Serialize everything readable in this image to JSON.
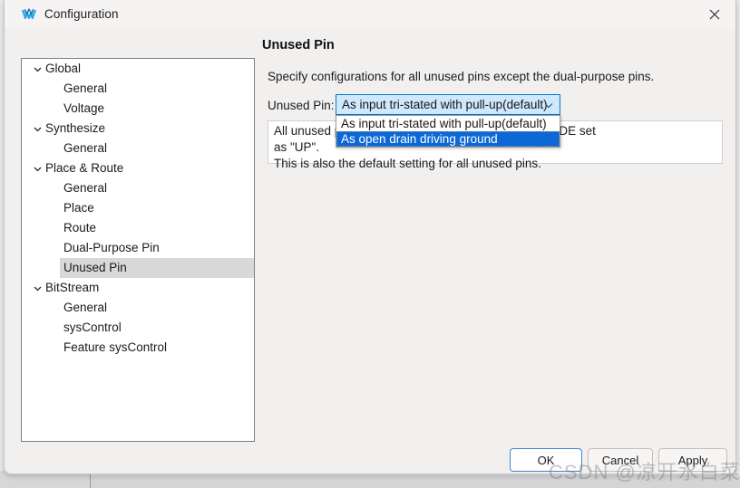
{
  "window": {
    "title": "Configuration",
    "app_icon": "w-logo-icon",
    "close_icon": "close-icon"
  },
  "sidebar": {
    "items": [
      {
        "label": "Global",
        "level": "top",
        "expanded": true,
        "selected": false,
        "icon": "chevron-down-icon"
      },
      {
        "label": "General",
        "level": "child",
        "expanded": false,
        "selected": false,
        "icon": ""
      },
      {
        "label": "Voltage",
        "level": "child",
        "expanded": false,
        "selected": false,
        "icon": ""
      },
      {
        "label": "Synthesize",
        "level": "top",
        "expanded": true,
        "selected": false,
        "icon": "chevron-down-icon"
      },
      {
        "label": "General",
        "level": "child",
        "expanded": false,
        "selected": false,
        "icon": ""
      },
      {
        "label": "Place & Route",
        "level": "top",
        "expanded": true,
        "selected": false,
        "icon": "chevron-down-icon"
      },
      {
        "label": "General",
        "level": "child",
        "expanded": false,
        "selected": false,
        "icon": ""
      },
      {
        "label": "Place",
        "level": "child",
        "expanded": false,
        "selected": false,
        "icon": ""
      },
      {
        "label": "Route",
        "level": "child",
        "expanded": false,
        "selected": false,
        "icon": ""
      },
      {
        "label": "Dual-Purpose Pin",
        "level": "child",
        "expanded": false,
        "selected": false,
        "icon": ""
      },
      {
        "label": "Unused Pin",
        "level": "child",
        "expanded": false,
        "selected": true,
        "icon": ""
      },
      {
        "label": "BitStream",
        "level": "top",
        "expanded": true,
        "selected": false,
        "icon": "chevron-down-icon"
      },
      {
        "label": "General",
        "level": "child",
        "expanded": false,
        "selected": false,
        "icon": ""
      },
      {
        "label": "sysControl",
        "level": "child",
        "expanded": false,
        "selected": false,
        "icon": ""
      },
      {
        "label": "Feature sysControl",
        "level": "child",
        "expanded": false,
        "selected": false,
        "icon": ""
      }
    ]
  },
  "main": {
    "title": "Unused Pin",
    "description": "Specify configurations for all unused pins except the dual-purpose pins.",
    "field": {
      "label": "Unused Pin:",
      "value": "As input tri-stated with pull-up(default)",
      "arrow_icon": "chevron-down-icon",
      "options": [
        {
          "label": "As input tri-stated with pull-up(default)",
          "highlighted": false
        },
        {
          "label": "As open drain driving ground",
          "highlighted": true
        }
      ]
    },
    "info": {
      "line1": "All unused pins are set as input tri-stated, PULL_MODE set",
      "line2": "as \"UP\".",
      "line3": "This is also the default setting for all unused pins."
    }
  },
  "footer": {
    "ok": "OK",
    "cancel": "Cancel",
    "apply": "Apply"
  },
  "watermark": {
    "text": "CSDN @凉开水白菜"
  },
  "colors": {
    "accent": "#0078d4",
    "highlight": "#0c68d6",
    "combo_fill": "#cfe8fb",
    "tree_selected": "#d8d8d8",
    "dialog_bg": "#f1f0ef"
  }
}
